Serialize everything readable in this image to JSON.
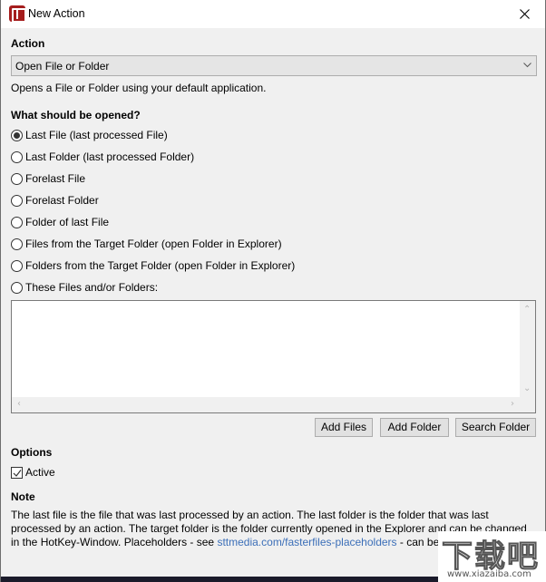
{
  "window": {
    "title": "New Action",
    "app_icon": "fasterfiles-app-icon",
    "close_icon": "close-icon"
  },
  "action": {
    "section_label": "Action",
    "selected": "Open File or Folder",
    "description": "Opens a File or Folder using your default application."
  },
  "what_opened": {
    "section_label": "What should be opened?",
    "options": [
      {
        "label": "Last File (last processed File)",
        "checked": true
      },
      {
        "label": "Last Folder (last processed Folder)",
        "checked": false
      },
      {
        "label": "Forelast File",
        "checked": false
      },
      {
        "label": "Forelast Folder",
        "checked": false
      },
      {
        "label": "Folder of last File",
        "checked": false
      },
      {
        "label": "Files from the Target Folder (open Folder in Explorer)",
        "checked": false
      },
      {
        "label": "Folders from the Target Folder (open Folder in Explorer)",
        "checked": false
      },
      {
        "label": "These Files and/or Folders:",
        "checked": false
      }
    ],
    "files_list_value": ""
  },
  "buttons": {
    "add_files": "Add Files",
    "add_folder": "Add Folder",
    "search_folder": "Search Folder"
  },
  "options": {
    "section_label": "Options",
    "active_label": "Active",
    "active_checked": true
  },
  "note": {
    "section_label": "Note",
    "text_before_link": "The last file is the file that was last processed by an action. The last folder is the folder that was last processed by an action. The target folder is the folder currently opened in the Explorer and can be changed in the HotKey-Window. Placeholders - see ",
    "link_text": "sttmedia.com/fasterfiles-placeholders",
    "text_after_link": " - can be used"
  },
  "watermark": {
    "big": "下载吧",
    "small": "www.xiazaiba.com"
  }
}
